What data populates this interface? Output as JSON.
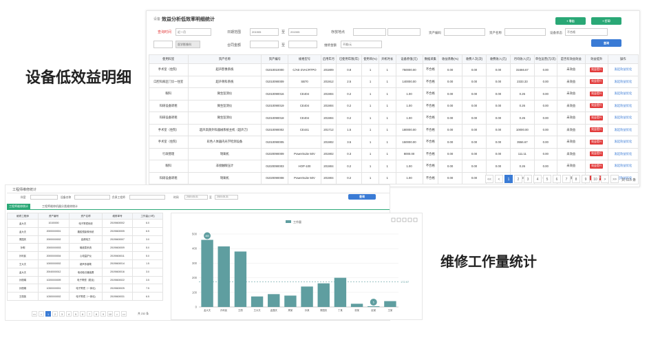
{
  "labels": {
    "equipment_detail": "设备低效益明细",
    "repair_stats": "维修工作量统计"
  },
  "top_panel": {
    "title": "效益分析低效率明细统计",
    "title_prefix": "设备",
    "btn_export": "+ 导出",
    "btn_print": "+ 打印",
    "btn_query": "查询",
    "filters": {
      "period_label": "查询时间",
      "period_value": "近一月",
      "date_label": "日期范围",
      "date_from": "201905",
      "date_sep": "至",
      "date_to": "201905",
      "place_label": "存放地点",
      "asset_code_label": "资产编码",
      "asset_name_label": "资产名称",
      "status_label": "设备状态",
      "status_value": "不合格",
      "dept_label": "部门",
      "dept_value": "医学影像科",
      "contract_label": "合同金额",
      "contract_sep": "至",
      "cost_label": "维修金额",
      "cost_value": "不限/元"
    },
    "table": {
      "headers": [
        "使用科室",
        "资产名称",
        "资产编号",
        "规格型号",
        "启用年月",
        "已使用年限(年)",
        "使用率(%)",
        "开机时长",
        "设备原值(元)",
        "数据采集",
        "收益系数(%)",
        "收费人次(次)",
        "收费收入(元)",
        "月均收入(元)",
        "单位运营(元/次)",
        "是否有效益效益",
        "效益提升",
        "操作"
      ],
      "rows": [
        [
          "手术室（住院）",
          "超声影像系统",
          "01010010000",
          "C/AE-2VACRTPO",
          "201809",
          "0.8",
          "1",
          "1",
          "750000.00",
          "不合格",
          "0.00",
          "0.00",
          "0.00",
          "31666.67",
          "0.00",
          "未效益",
          "效益提升",
          "发起效益优化"
        ],
        [
          "口腔科病区门诊一住室",
          "超声骨科系统",
          "01010090009",
          "SB70",
          "201912",
          "2.5",
          "1",
          "1",
          "140000.00",
          "不合格",
          "0.00",
          "0.00",
          "0.00",
          "2333.33",
          "0.00",
          "未效益",
          "效益提升",
          "发起效益优化"
        ],
        [
          "眼科",
          "微生监测仪",
          "01010090016",
          "CE404",
          "201904",
          "0.2",
          "1",
          "1",
          "1.00",
          "不合格",
          "0.00",
          "0.00",
          "0.00",
          "0.26",
          "0.00",
          "未效益",
          "效益提升",
          "发起效益优化"
        ],
        [
          "科研设备转租",
          "微生监测仪",
          "01010090019",
          "CE404",
          "201904",
          "0.2",
          "1",
          "1",
          "1.00",
          "不合格",
          "0.00",
          "0.00",
          "0.00",
          "0.26",
          "0.00",
          "未效益",
          "效益提升",
          "发起效益优化"
        ],
        [
          "科研设备转租",
          "微生监测仪",
          "01010090018",
          "CE404",
          "201904",
          "0.2",
          "1",
          "1",
          "1.00",
          "不合格",
          "0.00",
          "0.00",
          "0.00",
          "0.26",
          "0.00",
          "未效益",
          "效益提升",
          "发起效益优化"
        ],
        [
          "手术室（住院）",
          "超声高频外科器械系统主机（超声刀）",
          "01010090002",
          "CE441",
          "201712",
          "1.5",
          "1",
          "1",
          "180000.00",
          "不合格",
          "0.00",
          "0.00",
          "0.00",
          "10000.00",
          "0.00",
          "未效益",
          "效益提升",
          "发起效益优化"
        ],
        [
          "手术室（住院）",
          "彩色人体器内光学检测设备",
          "01010090005",
          "",
          "201902",
          "3.5",
          "1",
          "1",
          "150000.00",
          "不合格",
          "0.00",
          "0.00",
          "0.00",
          "3556.67",
          "0.00",
          "未效益",
          "效益提升",
          "发起效益优化"
        ],
        [
          "行政管理",
          "制氧机",
          "01020090009",
          "PowerSuite 50V",
          "201902",
          "0.3",
          "1",
          "1",
          "8000.00",
          "不合格",
          "0.00",
          "0.00",
          "0.00",
          "111.11",
          "0.00",
          "未效益",
          "效益提升",
          "发起效益优化"
        ],
        [
          "眼科",
          "非接触眼压计",
          "01020090003",
          "HOP-100",
          "201904",
          "0.2",
          "1",
          "1",
          "1.00",
          "不合格",
          "0.00",
          "0.00",
          "0.00",
          "0.26",
          "0.00",
          "未效益",
          "效益提升",
          "发起效益优化"
        ],
        [
          "科研设备转租",
          "制氧机",
          "01020090008",
          "PowerSuite 50V",
          "201904",
          "0.2",
          "1",
          "1",
          "1.00",
          "不合格",
          "0.00",
          "0.00",
          "0.00",
          "0.26",
          "0.00",
          "未效益",
          "效益提升",
          "发起效益优化"
        ]
      ]
    },
    "pagination": [
      "<<",
      "<",
      "1",
      "2",
      "3",
      "4",
      "5",
      "6",
      "7",
      "8",
      "9",
      "10",
      ">",
      ">>"
    ],
    "active_page": "1",
    "total": "共 515 条"
  },
  "bottom_panel": {
    "title": "工程师维修统计",
    "filters": {
      "kw_label": "科室",
      "device_label": "设备名称",
      "engineer_label": "负责工程师",
      "time_label": "时间",
      "time_from": "2019-05-01",
      "time_sep": "至",
      "time_to": "2019-05-31",
      "query_btn": "查询"
    },
    "tabs": [
      "工程师维修统计",
      "工程师维修机器分类维修统计"
    ],
    "table": {
      "headers": [
        "维修工程师",
        "资产编号",
        "资产名称",
        "维修单号",
        "工作量(小时)"
      ],
      "rows": [
        [
          "孟大夫",
          "10100000",
          "电子胃镜系统",
          "20190600002",
          "6.0"
        ],
        [
          "孟大夫",
          "20000000001",
          "腹腔镜影像系统",
          "20190600005",
          "6.5"
        ],
        [
          "周国庆",
          "20000000002",
          "高频电刀",
          "20190600007",
          "3.0"
        ],
        [
          "孙明",
          "20000000003",
          "输液泵系统",
          "20190600009",
          "5.0"
        ],
        [
          "孙利民",
          "20000000004",
          "心电监护仪",
          "20190600011",
          "5.0"
        ],
        [
          "王大夫",
          "10000000002",
          "超声多普勒",
          "20190600014",
          "1.5"
        ],
        [
          "孟大夫",
          "20040000012",
          "电动吸引器装置",
          "20190600016",
          "3.0"
        ],
        [
          "孙丽娟",
          "10200000009",
          "电子胃镜（麦克)",
          "20190600022",
          "3.5"
        ],
        [
          "孙丽娟",
          "10300000001",
          "电子胃镜（一体化)",
          "20190600025",
          "7.5"
        ],
        [
          "王丽英",
          "10300000002",
          "电子胃镜（一体化)",
          "20190600031",
          "6.5"
        ]
      ]
    },
    "pagination": [
      "<<",
      "<",
      "1",
      "2",
      "3",
      "4",
      "5",
      "6",
      "7",
      "8",
      "9",
      "10",
      ">",
      ">>"
    ],
    "active_page": "1",
    "total": "共 232 条",
    "chart_legend": "工作量"
  },
  "chart_data": {
    "type": "bar",
    "categories": [
      "孟大夫",
      "孙利民",
      "王丽",
      "王大夫",
      "孟国庆",
      "周某",
      "孙某",
      "周国庆",
      "丁某",
      "张某",
      "赵某",
      "王某"
    ],
    "values": [
      460,
      415,
      380,
      72,
      88,
      78,
      140,
      162,
      200,
      22,
      5,
      40
    ],
    "ylim": [
      0,
      500
    ],
    "yticks": [
      0,
      100,
      200,
      300,
      400,
      500
    ],
    "average_label": "172.97",
    "average_value": 172.97,
    "max_pin": "460",
    "min_pin": "5",
    "color": "#5f9ea0"
  },
  "colors": {
    "accent": "#3a7bd5",
    "green": "#2aa876",
    "red_badge": "#e23b3b",
    "link": "#3a7bd5",
    "bar": "#5f9ea0"
  }
}
